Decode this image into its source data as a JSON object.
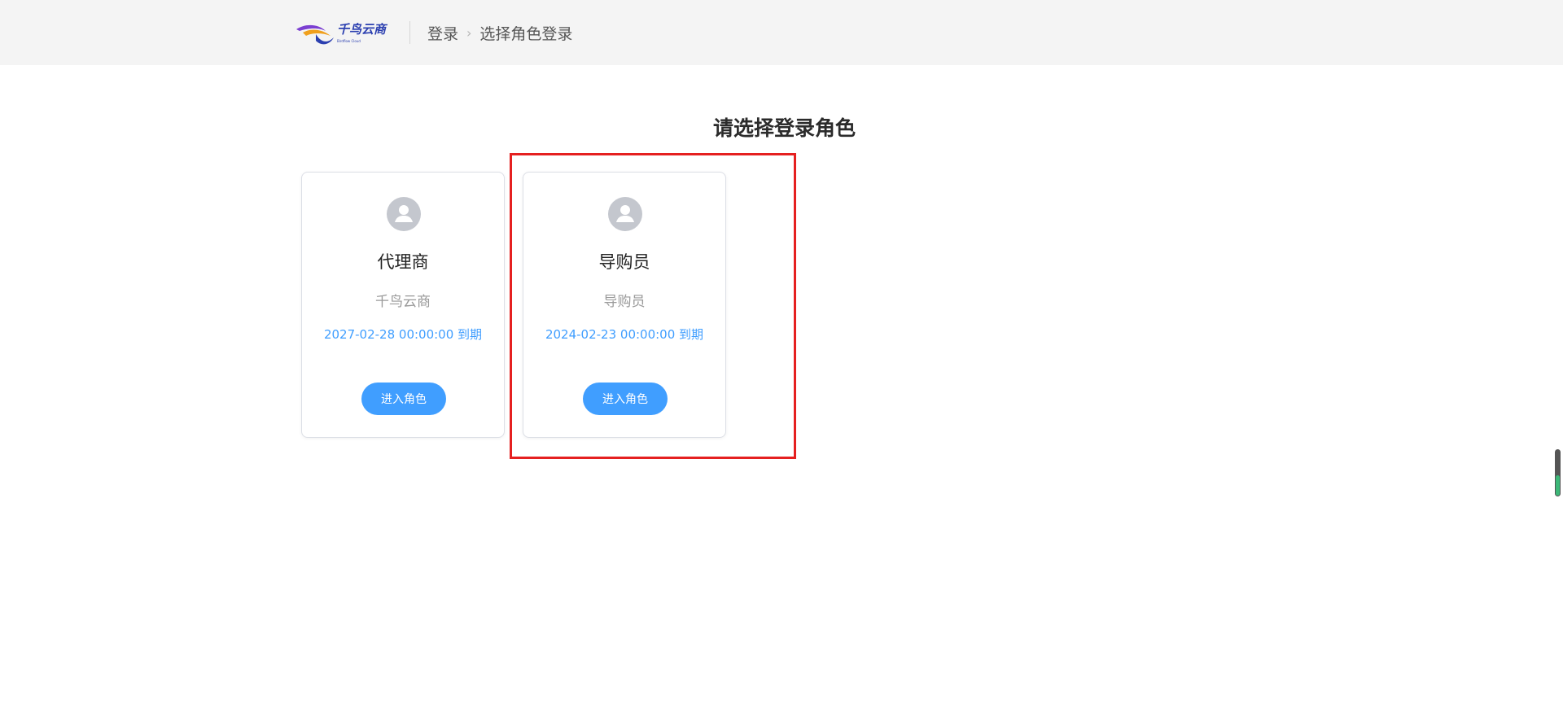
{
  "header": {
    "logo_text": "千鸟云商",
    "logo_subtext": "Birdflow Cloud",
    "breadcrumb": [
      "登录",
      "选择角色登录"
    ],
    "breadcrumb_separator": "›"
  },
  "main": {
    "title": "请选择登录角色",
    "roles": [
      {
        "role": "代理商",
        "org": "千鸟云商",
        "expiry": "2027-02-28 00:00:00 到期",
        "button_label": "进入角色",
        "avatar_icon": "user-avatar-icon"
      },
      {
        "role": "导购员",
        "org": "导购员",
        "expiry": "2024-02-23 00:00:00 到期",
        "button_label": "进入角色",
        "avatar_icon": "user-avatar-icon",
        "highlighted": true
      }
    ]
  },
  "colors": {
    "accent": "#409eff",
    "header_bg": "#f4f4f4",
    "highlight": "#e52020",
    "avatar_bg": "#c4c7ce",
    "scroll_fill": "#3cb878"
  },
  "scroll_indicator": {
    "level": 0.45
  }
}
